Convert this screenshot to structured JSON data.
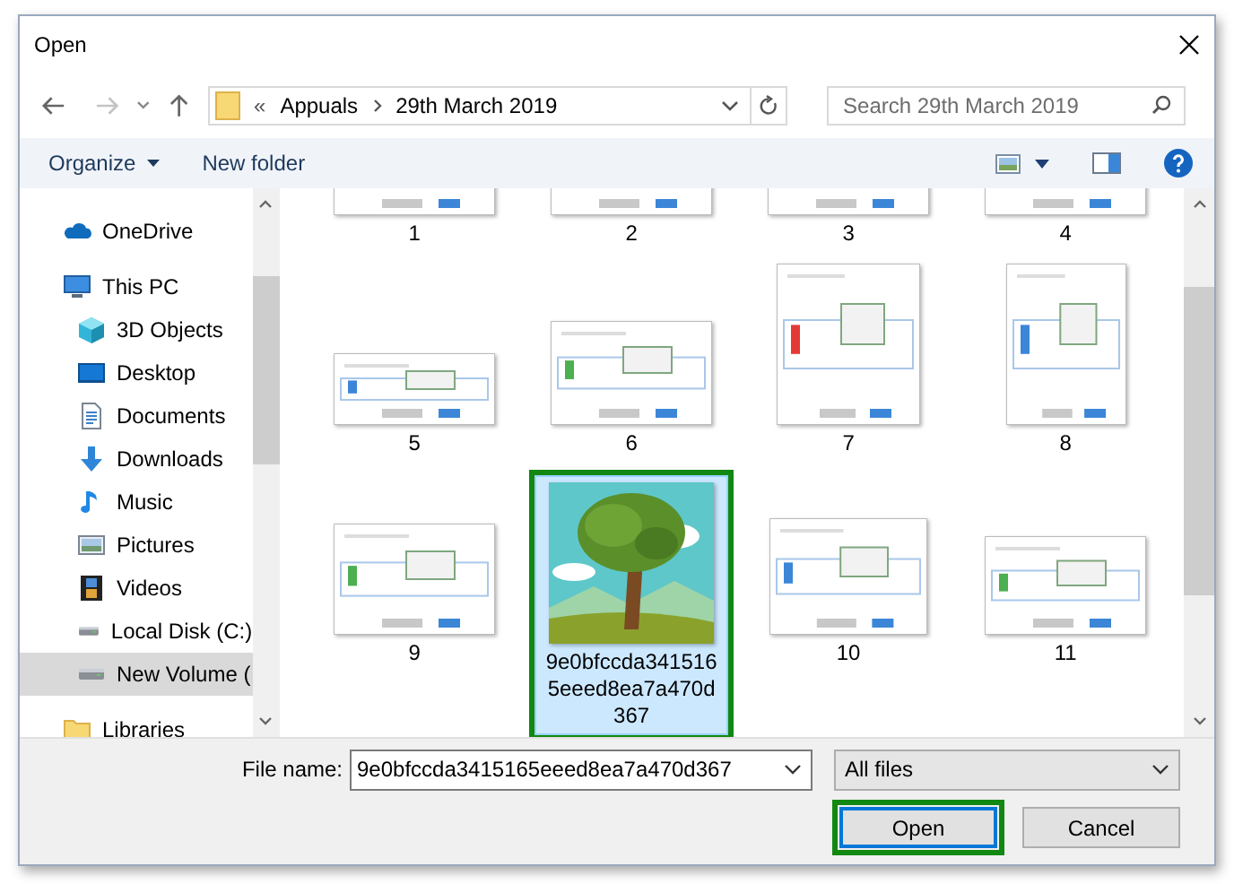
{
  "window": {
    "title": "Open"
  },
  "address_bar": {
    "overflow": "«",
    "segments": [
      "Appuals",
      "29th March 2019"
    ]
  },
  "search": {
    "placeholder": "Search 29th March 2019"
  },
  "toolbar": {
    "buttons": [
      {
        "label": "Organize",
        "kind": "menu"
      },
      {
        "label": "New folder",
        "kind": "plain"
      }
    ]
  },
  "sidebar": {
    "items": [
      {
        "label": "OneDrive",
        "kind": "cloud",
        "selected": false
      },
      {
        "label": "This PC",
        "kind": "computer",
        "selected": false,
        "children": [
          {
            "label": "3D Objects",
            "kind": "cube",
            "selected": false
          },
          {
            "label": "Desktop",
            "kind": "desktop",
            "selected": false
          },
          {
            "label": "Documents",
            "kind": "document",
            "selected": false
          },
          {
            "label": "Downloads",
            "kind": "download",
            "selected": false
          },
          {
            "label": "Music",
            "kind": "music",
            "selected": false
          },
          {
            "label": "Pictures",
            "kind": "pictures",
            "selected": false
          },
          {
            "label": "Videos",
            "kind": "videos",
            "selected": false
          },
          {
            "label": "Local Disk (C:)",
            "kind": "drive",
            "selected": false
          },
          {
            "label": "New Volume (",
            "kind": "drive",
            "selected": true
          }
        ]
      },
      {
        "label": "Libraries",
        "kind": "folder",
        "selected": false
      }
    ]
  },
  "files": [
    {
      "label": "1",
      "kind": "screenshot",
      "selected": false
    },
    {
      "label": "2",
      "kind": "screenshot",
      "selected": false
    },
    {
      "label": "3",
      "kind": "screenshot",
      "selected": false
    },
    {
      "label": "4",
      "kind": "screenshot",
      "selected": false
    },
    {
      "label": "5",
      "kind": "screenshot",
      "selected": false
    },
    {
      "label": "6",
      "kind": "screenshot",
      "selected": false
    },
    {
      "label": "7",
      "kind": "screenshot",
      "selected": false
    },
    {
      "label": "8",
      "kind": "screenshot",
      "selected": false
    },
    {
      "label": "9",
      "kind": "screenshot",
      "selected": false
    },
    {
      "label": "9e0bfccda3415165eeed8ea7a470d367",
      "kind": "illustration",
      "selected": true
    },
    {
      "label": "10",
      "kind": "screenshot",
      "selected": false
    },
    {
      "label": "11",
      "kind": "screenshot",
      "selected": false
    }
  ],
  "file_name": {
    "label": "File name:",
    "value": "9e0bfccda3415165eeed8ea7a470d367"
  },
  "file_type": {
    "value": "All files"
  },
  "buttons": [
    {
      "label": "Open",
      "default": true
    },
    {
      "label": "Cancel",
      "default": false
    }
  ]
}
